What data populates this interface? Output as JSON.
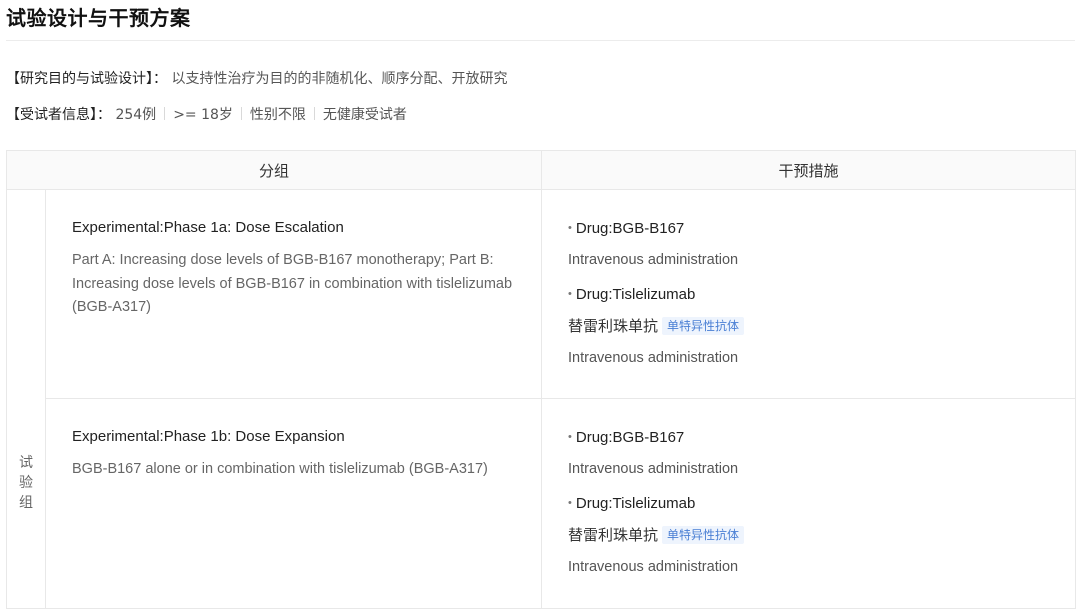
{
  "section": {
    "title": "试验设计与干预方案"
  },
  "info": {
    "purpose_key": "【研究目的与试验设计】：",
    "purpose_value": "以支持性治疗为目的的非随机化、顺序分配、开放研究",
    "subjects_key": "【受试者信息】：",
    "subjects": [
      "254例",
      ">= 18岁",
      "性别不限",
      "无健康受试者"
    ]
  },
  "table": {
    "headers": [
      "分组",
      "干预措施"
    ],
    "group_label": [
      "试",
      "验",
      "组"
    ],
    "rows": [
      {
        "arm_title": "Experimental:Phase 1a: Dose Escalation",
        "arm_desc": "Part A: Increasing dose levels of BGB-B167 monotherapy; Part B: Increasing dose levels of BGB-B167 in combination with tislelizumab (BGB-A317)",
        "drugs": [
          {
            "name": "Drug:BGB-B167",
            "cn_name": "",
            "tag": "",
            "route": "Intravenous administration"
          },
          {
            "name": "Drug:Tislelizumab",
            "cn_name": "替雷利珠单抗",
            "tag": "单特异性抗体",
            "route": "Intravenous administration"
          }
        ]
      },
      {
        "arm_title": "Experimental:Phase 1b: Dose Expansion",
        "arm_desc": "BGB-B167 alone or in combination with tislelizumab (BGB-A317)",
        "drugs": [
          {
            "name": "Drug:BGB-B167",
            "cn_name": "",
            "tag": "",
            "route": "Intravenous administration"
          },
          {
            "name": "Drug:Tislelizumab",
            "cn_name": "替雷利珠单抗",
            "tag": "单特异性抗体",
            "route": "Intravenous administration"
          }
        ]
      }
    ]
  },
  "icons": {
    "bullet": "•"
  },
  "colors": {
    "tag_text": "#4a7fd4",
    "tag_bg": "#eef4fd",
    "header_bg": "#fafafa",
    "border": "#e8e8e8"
  }
}
